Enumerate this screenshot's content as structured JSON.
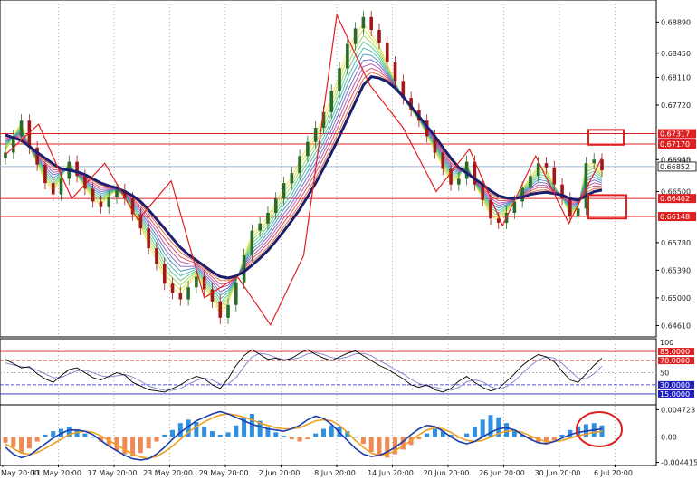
{
  "chart_data": {
    "type": "line",
    "price_axis": {
      "ticks": [
        0.6889,
        0.6845,
        0.6811,
        0.6772,
        0.6695,
        0.665,
        0.6578,
        0.6539,
        0.65,
        0.6461
      ],
      "tick_labels": [
        "0.68890",
        "0.68450",
        "0.68110",
        "0.67720",
        "0.66950",
        "0.66500",
        "0.65780",
        "0.65390",
        "0.65000",
        "0.64610"
      ],
      "ylim": [
        0.6445,
        0.6915
      ]
    },
    "time_labels": [
      "May 20:00",
      "11 May 20:00",
      "17 May 20:00",
      "23 May 20:00",
      "29 May 20:00",
      "2 Jun 20:00",
      "8 Jun 20:00",
      "14 Jun 20:00",
      "20 Jun 20:00",
      "26 Jun 20:00",
      "30 Jun 20:00",
      "6 Jul 20:00"
    ],
    "levels": [
      {
        "label": "0.67317",
        "value": 0.67317,
        "color": "#e02020"
      },
      {
        "label": "0.67170",
        "value": 0.6717,
        "color": "#e02020"
      },
      {
        "label": "0.66852",
        "value": 0.66852,
        "color": "#9bb6d6"
      },
      {
        "label": "0.66402",
        "value": 0.66402,
        "color": "#e02020"
      },
      {
        "label": "0.66148",
        "value": 0.66148,
        "color": "#e02020"
      }
    ],
    "current_price_label": "0.66852",
    "current_price_label_2": "0.66945",
    "close_series": [
      0.6705,
      0.6728,
      0.675,
      0.6712,
      0.6688,
      0.6662,
      0.6646,
      0.6668,
      0.6692,
      0.6672,
      0.6654,
      0.6636,
      0.6628,
      0.6642,
      0.6652,
      0.664,
      0.6618,
      0.6598,
      0.657,
      0.6548,
      0.652,
      0.6507,
      0.6498,
      0.6515,
      0.653,
      0.6512,
      0.6495,
      0.6472,
      0.649,
      0.6522,
      0.656,
      0.6595,
      0.6605,
      0.662,
      0.664,
      0.6662,
      0.6676,
      0.67,
      0.672,
      0.674,
      0.6762,
      0.6792,
      0.6824,
      0.6858,
      0.688,
      0.6896,
      0.6878,
      0.686,
      0.6832,
      0.6806,
      0.6782,
      0.6765,
      0.675,
      0.6728,
      0.6705,
      0.6682,
      0.666,
      0.6668,
      0.6692,
      0.666,
      0.6638,
      0.6612,
      0.6606,
      0.662,
      0.6636,
      0.6655,
      0.6672,
      0.669,
      0.6684,
      0.666,
      0.664,
      0.6615,
      0.6626,
      0.669,
      0.6695,
      0.668
    ],
    "ma_series": [
      0.673,
      0.6726,
      0.6722,
      0.6714,
      0.6705,
      0.6697,
      0.6689,
      0.6682,
      0.668,
      0.6678,
      0.6674,
      0.6668,
      0.6662,
      0.6658,
      0.6655,
      0.665,
      0.6644,
      0.6636,
      0.6624,
      0.6611,
      0.6598,
      0.6584,
      0.6571,
      0.6561,
      0.6553,
      0.6545,
      0.6537,
      0.653,
      0.6528,
      0.6531,
      0.6537,
      0.6546,
      0.6556,
      0.6567,
      0.658,
      0.6594,
      0.6609,
      0.6625,
      0.6643,
      0.6662,
      0.6683,
      0.6705,
      0.6728,
      0.6752,
      0.6776,
      0.68,
      0.6812,
      0.681,
      0.6805,
      0.6796,
      0.6784,
      0.677,
      0.6756,
      0.6742,
      0.6728,
      0.6712,
      0.6697,
      0.6684,
      0.6676,
      0.6668,
      0.666,
      0.6651,
      0.6644,
      0.6641,
      0.664,
      0.6642,
      0.6646,
      0.6648,
      0.6649,
      0.6647,
      0.6645,
      0.664,
      0.6638,
      0.6644,
      0.665,
      0.6652
    ],
    "zigzag_series": [
      0.6702,
      0.6745,
      0.664,
      0.669,
      0.661,
      0.6665,
      0.65,
      0.653,
      0.6462,
      0.656,
      0.6899,
      0.68,
      0.674,
      0.665,
      0.671,
      0.6602,
      0.67,
      0.6605,
      0.6698
    ],
    "stoch_axis": {
      "ticks": [
        100,
        85,
        70,
        50,
        30,
        15
      ],
      "tick_labels": [
        "100",
        "85.0000",
        "70.0000",
        "50",
        "30.0000",
        "15.0000"
      ],
      "ylim": [
        0,
        100
      ]
    },
    "stoch_k": [
      72,
      65,
      58,
      60,
      48,
      40,
      34,
      45,
      55,
      58,
      50,
      42,
      38,
      44,
      50,
      46,
      34,
      28,
      22,
      20,
      18,
      24,
      30,
      38,
      44,
      40,
      30,
      24,
      40,
      62,
      78,
      88,
      80,
      72,
      74,
      70,
      74,
      82,
      88,
      80,
      74,
      70,
      76,
      82,
      86,
      78,
      70,
      62,
      56,
      48,
      40,
      30,
      26,
      30,
      22,
      18,
      24,
      36,
      44,
      34,
      26,
      20,
      24,
      36,
      48,
      62,
      72,
      80,
      76,
      68,
      52,
      38,
      34,
      48,
      62,
      74
    ],
    "stoch_d": [
      66,
      63,
      60,
      58,
      54,
      48,
      42,
      42,
      48,
      53,
      54,
      50,
      45,
      43,
      45,
      47,
      43,
      36,
      28,
      24,
      21,
      21,
      24,
      31,
      37,
      41,
      38,
      31,
      31,
      42,
      60,
      76,
      82,
      80,
      75,
      72,
      72,
      75,
      81,
      83,
      80,
      75,
      73,
      76,
      81,
      82,
      78,
      70,
      63,
      55,
      48,
      39,
      32,
      28,
      26,
      23,
      21,
      26,
      35,
      38,
      35,
      27,
      23,
      27,
      36,
      49,
      61,
      71,
      76,
      74,
      65,
      53,
      41,
      40,
      48,
      61
    ],
    "macd_axis": {
      "ticks": [
        0.004723,
        0.0,
        -0.004415
      ],
      "tick_labels": [
        "0.004723",
        "0.00",
        "-0.004415"
      ],
      "ylim": [
        -0.0048,
        0.0051
      ]
    },
    "macd_hist": [
      -0.001,
      -0.0018,
      -0.0028,
      -0.002,
      -0.0008,
      0.0004,
      0.001,
      0.0014,
      0.0018,
      0.0012,
      0.0006,
      0.0,
      -0.0008,
      -0.0016,
      -0.0024,
      -0.003,
      -0.0034,
      -0.0028,
      -0.002,
      -0.0008,
      0.0004,
      0.0012,
      0.0024,
      0.003,
      0.0026,
      0.0018,
      0.001,
      0.0004,
      0.0008,
      0.002,
      0.0034,
      0.004,
      0.0028,
      0.0016,
      0.0008,
      0.0002,
      -0.0004,
      -0.0008,
      -0.0004,
      0.0006,
      0.0014,
      0.002,
      0.0018,
      0.001,
      0.0,
      -0.0012,
      -0.0026,
      -0.0034,
      -0.0036,
      -0.003,
      -0.0022,
      -0.0014,
      -0.0004,
      0.0006,
      0.0014,
      0.001,
      0.0004,
      -0.0002,
      0.0006,
      0.0018,
      0.003,
      0.0038,
      0.0034,
      0.0024,
      0.0012,
      0.0004,
      -0.0004,
      -0.001,
      -0.0012,
      -0.0006,
      0.0004,
      0.0012,
      0.0018,
      0.0022,
      0.0024,
      0.002
    ],
    "macd_line": [
      -0.0018,
      -0.003,
      -0.0036,
      -0.0032,
      -0.0022,
      -0.0012,
      -0.0002,
      0.0006,
      0.0012,
      0.0012,
      0.001,
      0.0004,
      -0.0006,
      -0.0016,
      -0.0024,
      -0.0032,
      -0.0038,
      -0.004,
      -0.0038,
      -0.003,
      -0.0018,
      -0.0004,
      0.0008,
      0.0018,
      0.0028,
      0.0034,
      0.004,
      0.0044,
      0.004,
      0.0034,
      0.0028,
      0.0022,
      0.0018,
      0.0014,
      0.0012,
      0.001,
      0.0014,
      0.002,
      0.003,
      0.0036,
      0.0032,
      0.0022,
      0.0008,
      -0.0006,
      -0.002,
      -0.003,
      -0.0034,
      -0.0032,
      -0.0026,
      -0.0018,
      -0.0008,
      0.0004,
      0.0014,
      0.002,
      0.0018,
      0.001,
      0.0,
      -0.0008,
      -0.0012,
      -0.0008,
      0.0,
      0.0008,
      0.0014,
      0.0016,
      0.0012,
      0.0004,
      -0.0004,
      -0.001,
      -0.0012,
      -0.0008,
      -0.0002,
      0.0004,
      0.0008,
      0.001,
      0.0012,
      0.0014
    ],
    "macd_signal": [
      -0.0012,
      -0.002,
      -0.0028,
      -0.003,
      -0.0027,
      -0.002,
      -0.0012,
      -0.0004,
      0.0004,
      0.0008,
      0.001,
      0.0008,
      0.0002,
      -0.0006,
      -0.0014,
      -0.0022,
      -0.003,
      -0.0035,
      -0.0037,
      -0.0034,
      -0.0026,
      -0.0016,
      -0.0004,
      0.0008,
      0.0018,
      0.0026,
      0.0033,
      0.0038,
      0.004,
      0.0038,
      0.0034,
      0.003,
      0.0024,
      0.002,
      0.0016,
      0.0014,
      0.0014,
      0.0016,
      0.0022,
      0.0028,
      0.003,
      0.0028,
      0.002,
      0.0008,
      -0.0006,
      -0.0018,
      -0.0028,
      -0.0032,
      -0.003,
      -0.0024,
      -0.0016,
      -0.0006,
      0.0004,
      0.0012,
      0.0016,
      0.0014,
      0.0008,
      0.0,
      -0.0006,
      -0.0008,
      -0.0006,
      0.0,
      0.0006,
      0.001,
      0.0011,
      0.0008,
      0.0002,
      -0.0004,
      -0.0008,
      -0.0008,
      -0.0006,
      -0.0002,
      0.0002,
      0.0005,
      0.0008,
      0.001
    ],
    "colors": {
      "background": "#ffffff",
      "zigzag": "#e02020",
      "ma": "#1c1f6e",
      "stoch_k": "#000000",
      "stoch_d": "#8080d0",
      "macd_hist_pos": "#2f8fe0",
      "macd_hist_neg": "#f08a55",
      "macd_line": "#1c3ea8",
      "macd_signal": "#f0a020",
      "highlight": "#e02020"
    },
    "grid": true
  }
}
